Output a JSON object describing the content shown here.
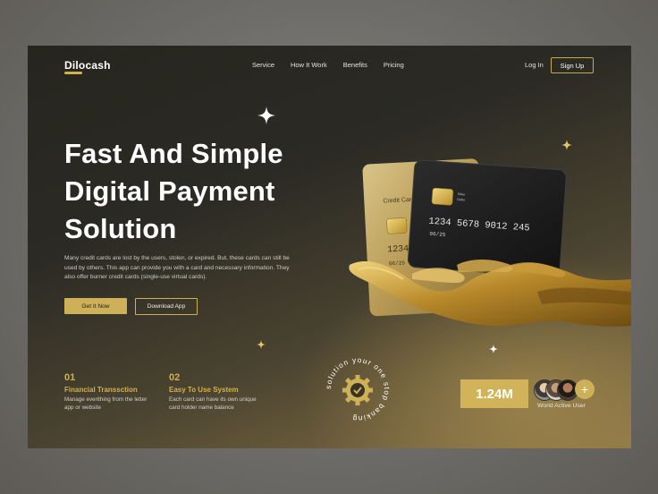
{
  "brand": {
    "name": "Dilocash"
  },
  "nav": {
    "items": [
      "Service",
      "How It Work",
      "Benefits",
      "Pricing"
    ],
    "login": "Log In",
    "signup": "Sign Up"
  },
  "hero": {
    "title_lines": [
      "Fast And Simple",
      "Digital Payment",
      "Solution"
    ],
    "description": "Many credit cards are lost by the users, stolen, or expired. But, these cards can still be used by others. This app can provide you with a card and necessary information. They also offer burner credit cards (single-use virtual cards).",
    "primary_button": "Get It Now",
    "secondary_button": "Download App"
  },
  "cards": {
    "front_number": "1234  5678  9012  245",
    "front_expiry": "06/25",
    "front_chip_label_1": "Silver",
    "front_chip_label_2": "Gaba",
    "back_label": "Credit Card",
    "back_number": "1234",
    "back_expiry": "06/25"
  },
  "features": [
    {
      "num": "01",
      "title": "Financial Transsction",
      "text": "Manage everithing from the letter app or website"
    },
    {
      "num": "02",
      "title": "Easy To Use System",
      "text": "Each  card can have its own unique card holder name balance"
    }
  ],
  "badge": {
    "text": "solution your one stop banking "
  },
  "stats": {
    "value": "1.24M",
    "label": "World Active User",
    "plus": "+"
  },
  "colors": {
    "accent": "#cdb057",
    "dark": "#26261f",
    "text_light": "#e6e3dc"
  }
}
